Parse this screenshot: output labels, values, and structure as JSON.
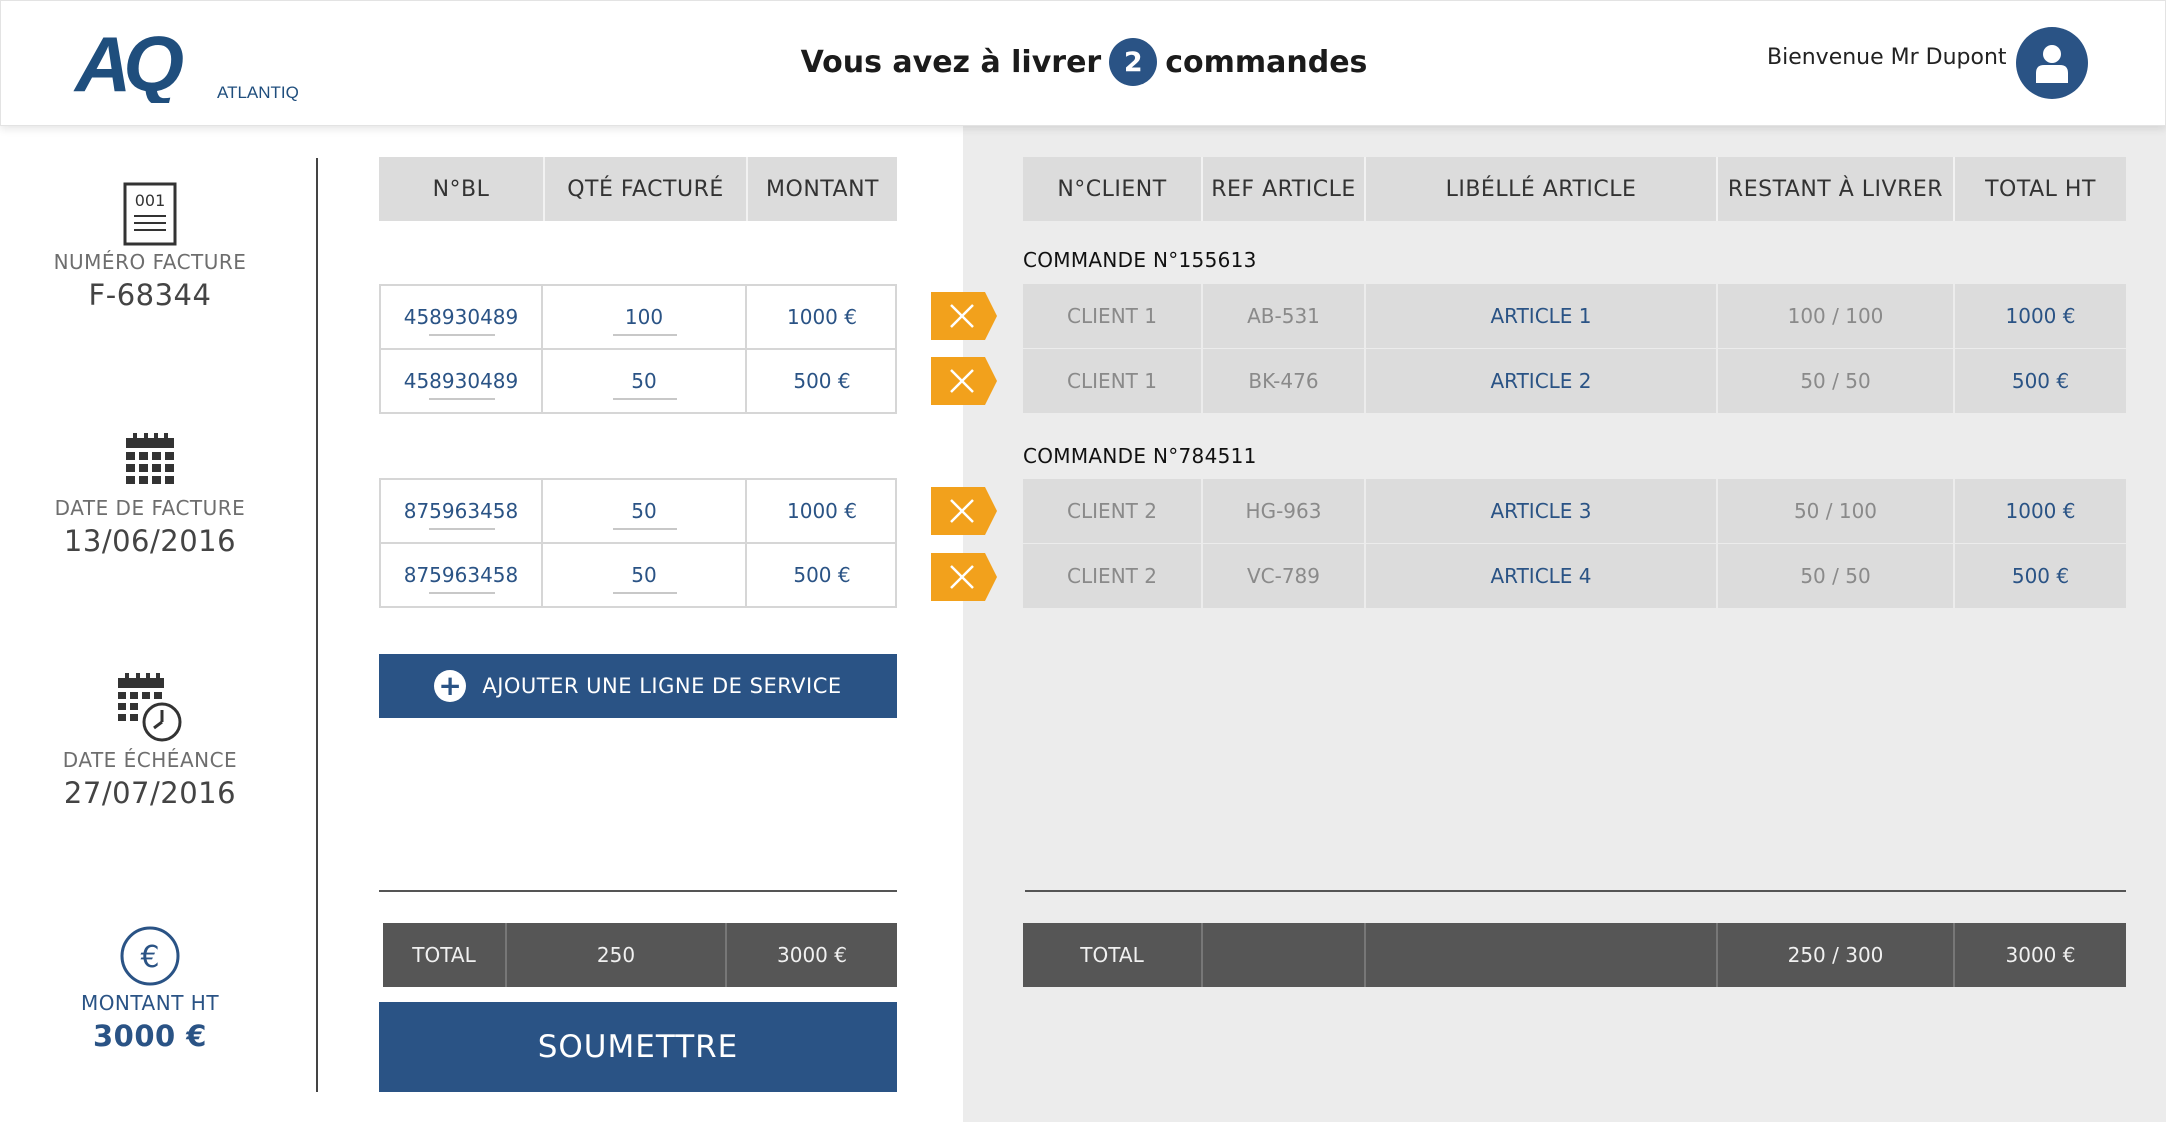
{
  "header": {
    "brand_short": "AQ",
    "brand_name": "ATLANTIQ",
    "title_before": "Vous avez à livrer",
    "order_count": "2",
    "title_after": "commandes",
    "welcome": "Bienvenue Mr Dupont"
  },
  "sidebar": {
    "invoice_icon_text": "001",
    "invoice_number_label": "NUMÉRO FACTURE",
    "invoice_number": "F-68344",
    "invoice_date_label": "DATE DE FACTURE",
    "invoice_date": "13/06/2016",
    "due_date_label": "DATE ÉCHÉANCE",
    "due_date": "27/07/2016",
    "amount_label": "MONTANT HT",
    "amount": "3000 €",
    "euro_symbol": "€"
  },
  "left_table": {
    "headers": [
      "N°BL",
      "QTÉ FACTURÉ",
      "MONTANT"
    ],
    "groups": [
      {
        "rows": [
          {
            "bl": "458930489",
            "qty": "100",
            "amount": "1000 €"
          },
          {
            "bl": "458930489",
            "qty": "50",
            "amount": "500 €"
          }
        ]
      },
      {
        "rows": [
          {
            "bl": "875963458",
            "qty": "50",
            "amount": "1000 €"
          },
          {
            "bl": "875963458",
            "qty": "50",
            "amount": "500 €"
          }
        ]
      }
    ],
    "add_service_label": "AJOUTER UNE LIGNE DE SERVICE",
    "total": {
      "label": "TOTAL",
      "qty": "250",
      "amount": "3000 €"
    },
    "submit_label": "SOUMETTRE"
  },
  "right_table": {
    "headers": [
      "N°CLIENT",
      "REF ARTICLE",
      "LIBÉLLÉ ARTICLE",
      "RESTANT À LIVRER",
      "TOTAL HT"
    ],
    "orders": [
      {
        "title": "COMMANDE N°155613",
        "rows": [
          {
            "client": "CLIENT 1",
            "ref": "AB-531",
            "article": "ARTICLE 1",
            "remaining": "100 / 100",
            "total": "1000 €"
          },
          {
            "client": "CLIENT 1",
            "ref": "BK-476",
            "article": "ARTICLE 2",
            "remaining": "50 / 50",
            "total": "500 €"
          }
        ]
      },
      {
        "title": "COMMANDE N°784511",
        "rows": [
          {
            "client": "CLIENT 2",
            "ref": "HG-963",
            "article": "ARTICLE 3",
            "remaining": "50 / 100",
            "total": "1000 €"
          },
          {
            "client": "CLIENT 2",
            "ref": "VC-789",
            "article": "ARTICLE 4",
            "remaining": "50 / 50",
            "total": "500 €"
          }
        ]
      }
    ],
    "total": {
      "label": "TOTAL",
      "remaining": "250 / 300",
      "amount": "3000 €"
    }
  },
  "colors": {
    "brand_blue": "#2a5385",
    "delete_orange": "#f2a11c",
    "total_bar": "#565656",
    "panel_grey": "#ececec"
  },
  "icons": {
    "invoice": "invoice-document-icon",
    "invoice_date": "calendar-icon",
    "due_date": "calendar-clock-icon",
    "amount": "euro-circle-icon",
    "avatar": "user-icon",
    "delete": "close-x-icon",
    "add": "plus-circle-icon"
  }
}
